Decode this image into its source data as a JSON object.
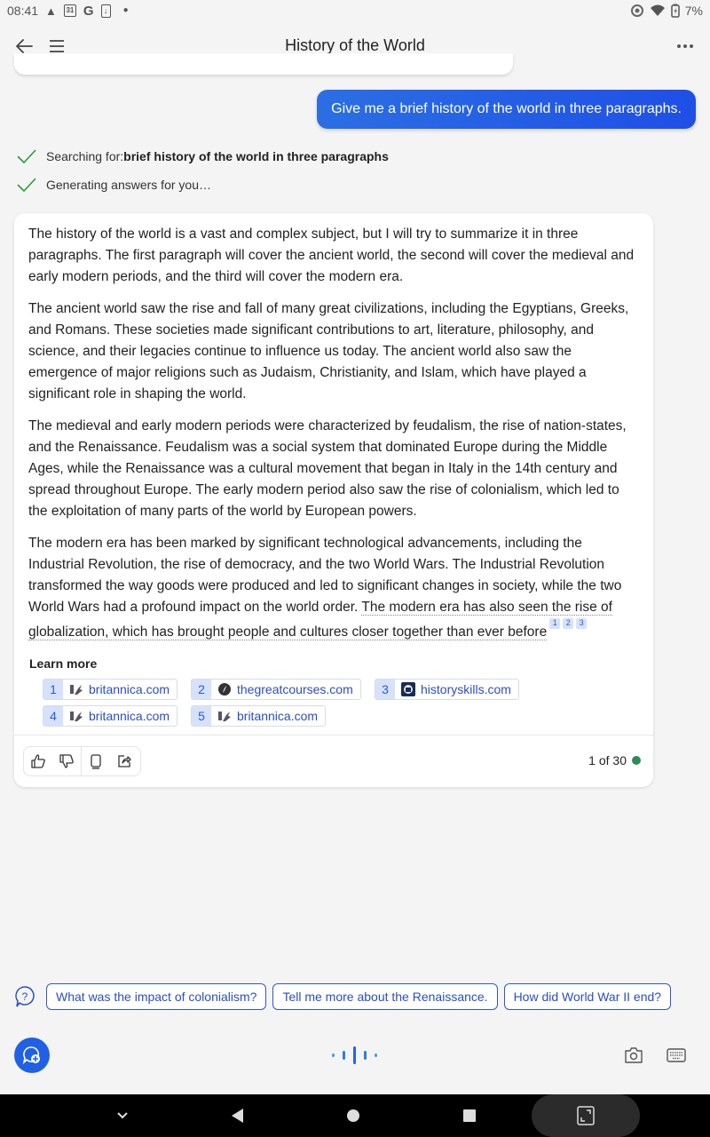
{
  "status_bar": {
    "time": "08:41",
    "left_icons": [
      "warning-icon",
      "calendar-icon",
      "google-icon",
      "download-icon",
      "dot-icon"
    ],
    "calendar_day": "31",
    "right_icons": [
      "data-saver-icon",
      "wifi-icon",
      "battery-charging-icon"
    ],
    "battery": "7%"
  },
  "app_bar": {
    "title": "History of the World",
    "back_icon": "arrow-left-icon",
    "menu_icon": "hamburger-menu-icon",
    "more_icon": "more-horizontal-icon"
  },
  "conversation": {
    "user_message": "Give me a brief history of the world in three paragraphs.",
    "progress": [
      {
        "prefix": "Searching for: ",
        "bold": "brief history of the world in three paragraphs"
      },
      {
        "prefix": "Generating answers for you…",
        "bold": ""
      }
    ],
    "answer": {
      "paragraphs": [
        "The history of the world is a vast and complex subject, but I will try to summarize it in three paragraphs. The first paragraph will cover the ancient world, the second will cover the medieval and early modern periods, and the third will cover the modern era.",
        "The ancient world saw the rise and fall of many great civilizations, including the Egyptians, Greeks, and Romans. These societies made significant contributions to art, literature, philosophy, and science, and their legacies continue to influence us today. The ancient world also saw the emergence of major religions such as Judaism, Christianity, and Islam, which have played a significant role in shaping the world.",
        "The medieval and early modern periods were characterized by feudalism, the rise of nation-states, and the Renaissance. Feudalism was a social system that dominated Europe during the Middle Ages, while the Renaissance was a cultural movement that began in Italy in the 14th century and spread throughout Europe. The early modern period also saw the rise of colonialism, which led to the exploitation of many parts of the world by European powers."
      ],
      "last_paragraph_plain": "The modern era has been marked by significant technological advancements, including the Industrial Revolution, the rise of democracy, and the two World Wars. The Industrial Revolution transformed the way goods were produced and led to significant changes in society, while the two World Wars had a profound impact on the world order. ",
      "last_paragraph_cited": "The modern era has also seen the rise of globalization, which has brought people and cultures closer together than ever before",
      "citations": [
        "1",
        "2",
        "3"
      ],
      "learn_more_label": "Learn more",
      "sources": [
        {
          "num": "1",
          "domain": "britannica.com",
          "favicon": "britannica-icon"
        },
        {
          "num": "2",
          "domain": "thegreatcourses.com",
          "favicon": "thegreatcourses-icon"
        },
        {
          "num": "3",
          "domain": "historyskills.com",
          "favicon": "historyskills-icon"
        },
        {
          "num": "4",
          "domain": "britannica.com",
          "favicon": "britannica-icon"
        },
        {
          "num": "5",
          "domain": "britannica.com",
          "favicon": "britannica-icon"
        }
      ],
      "feedback_icons": [
        "thumbs-up-icon",
        "thumbs-down-icon",
        "copy-icon",
        "share-icon"
      ],
      "turn_count": "1 of 30",
      "turn_status_color": "#2e8b57"
    }
  },
  "suggestions": {
    "icon": "question-bubble-icon",
    "chips": [
      "What was the impact of colonialism?",
      "Tell me more about the Renaissance.",
      "How did World War II end?"
    ]
  },
  "input_bar": {
    "new_chat_icon": "new-chat-icon",
    "mic_icon": "voice-wave-icon",
    "camera_icon": "camera-icon",
    "keyboard_icon": "keyboard-icon"
  },
  "nav_bar": {
    "icons": [
      "collapse-chevron-icon",
      "back-triangle-icon",
      "home-circle-icon",
      "recents-square-icon",
      "rotate-screen-icon"
    ]
  },
  "colors": {
    "accent": "#2060e6",
    "user_bubble_start": "#2b6fe4",
    "user_bubble_end": "#1f4fe6",
    "link": "#2a4fc0",
    "citation_bg": "#d6e2fb",
    "check": "#2e9b3a"
  }
}
